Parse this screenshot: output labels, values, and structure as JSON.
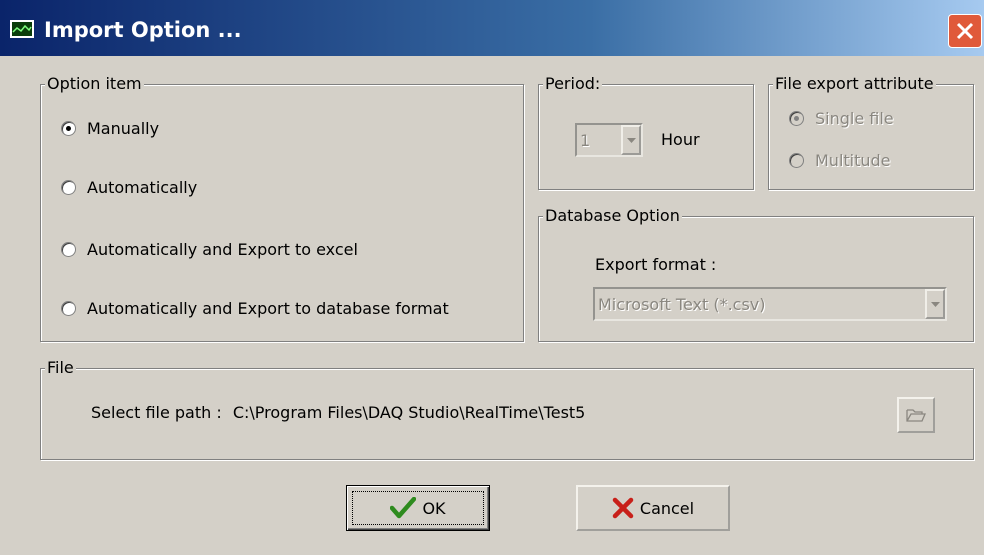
{
  "window": {
    "title": "Import Option ...",
    "title_icon": "chart-icon",
    "close_icon": "close-icon"
  },
  "option_item": {
    "legend": "Option item",
    "options": [
      {
        "label": "Manually",
        "checked": true
      },
      {
        "label": "Automatically",
        "checked": false
      },
      {
        "label": "Automatically and Export to excel",
        "checked": false
      },
      {
        "label": "Automatically and Export to database format",
        "checked": false
      }
    ]
  },
  "period": {
    "legend": "Period:",
    "value": "1",
    "unit_label": "Hour"
  },
  "file_export": {
    "legend": "File export attribute",
    "options": [
      {
        "label": "Single file",
        "checked": true
      },
      {
        "label": "Multitude",
        "checked": false
      }
    ]
  },
  "database_option": {
    "legend": "Database Option",
    "export_format_label": "Export format :",
    "export_format_value": "Microsoft Text (*.csv)"
  },
  "file": {
    "legend": "File",
    "path_label": "Select file path :",
    "path_value": "C:\\Program Files\\DAQ Studio\\RealTime\\Test5",
    "browse_icon": "folder-open-icon"
  },
  "buttons": {
    "ok_label": "OK",
    "ok_icon": "checkmark-icon",
    "cancel_label": "Cancel",
    "cancel_icon": "x-icon"
  },
  "colors": {
    "title_gradient_start": "#0a246a",
    "title_gradient_end": "#a6caf0",
    "dialog_face": "#d4d0c8",
    "ok_check": "#2e8b1e",
    "cancel_x": "#c8201a",
    "close_button": "#e05a3a"
  }
}
